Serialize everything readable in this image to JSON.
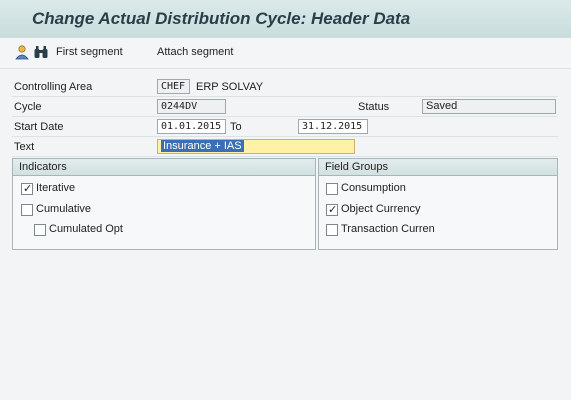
{
  "window": {
    "title": "Change Actual Distribution Cycle: Header Data"
  },
  "toolbar": {
    "icon1": "person-icon",
    "icon2": "binoculars-icon",
    "first_segment": "First segment",
    "attach_segment": "Attach segment"
  },
  "form": {
    "controlling_area": {
      "label": "Controlling Area",
      "value": "CHEF",
      "description": "ERP SOLVAY"
    },
    "cycle": {
      "label": "Cycle",
      "value": "0244DV"
    },
    "status": {
      "label": "Status",
      "value": "Saved"
    },
    "start_date": {
      "label": "Start Date",
      "value": "01.01.2015"
    },
    "to": {
      "label": "To",
      "value": "31.12.2015"
    },
    "text": {
      "label": "Text",
      "value": "Insurance + IAS"
    }
  },
  "indicators": {
    "title": "Indicators",
    "iterative": {
      "label": "Iterative",
      "checked": true
    },
    "cumulative": {
      "label": "Cumulative",
      "checked": false
    },
    "cumulated_opt": {
      "label": "Cumulated Opt",
      "checked": false
    }
  },
  "field_groups": {
    "title": "Field Groups",
    "consumption": {
      "label": "Consumption",
      "checked": false
    },
    "object_currency": {
      "label": "Object Currency",
      "checked": true
    },
    "transaction_curren": {
      "label": "Transaction Curren",
      "checked": false
    }
  },
  "colors": {
    "title_bar": "#cfe1e1",
    "highlight_field": "#fff2a8",
    "selection": "#3b6fb5"
  }
}
